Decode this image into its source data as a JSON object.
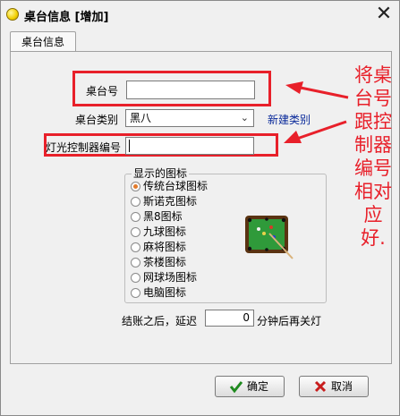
{
  "window": {
    "title": "桌台信息 [增加]",
    "close_glyph": "✕"
  },
  "tabs": [
    {
      "label": "桌台信息"
    }
  ],
  "form": {
    "table_number_label": "桌台号",
    "table_number_value": "",
    "table_type_label": "桌台类别",
    "table_type_value": "黑八",
    "new_type_link": "新建类别",
    "light_controller_label": "灯光控制器编号",
    "light_controller_value": ""
  },
  "icon_group": {
    "legend": "显示的图标",
    "options": [
      {
        "label": "传统台球图标",
        "selected": true
      },
      {
        "label": "斯诺克图标",
        "selected": false
      },
      {
        "label": "黑8图标",
        "selected": false
      },
      {
        "label": "九球图标",
        "selected": false
      },
      {
        "label": "麻将图标",
        "selected": false
      },
      {
        "label": "茶楼图标",
        "selected": false
      },
      {
        "label": "网球场图标",
        "selected": false
      },
      {
        "label": "电脑图标",
        "selected": false
      }
    ],
    "preview_icon": "billiard-table-icon"
  },
  "checkout": {
    "prefix": "结账之后，延迟",
    "delay_value": "0",
    "suffix": "分钟后再关灯"
  },
  "annotation": {
    "lines": [
      "将桌",
      "台号",
      "跟控",
      "制器",
      "编号",
      "相对",
      "应好."
    ]
  },
  "buttons": {
    "ok_label": "确定",
    "cancel_label": "取消"
  },
  "colors": {
    "highlight_red": "#e8202a",
    "link_blue": "#0a2a9a",
    "selected_radio": "#e27b2b",
    "ok_check": "#1f8a1f",
    "cancel_x": "#c81d1d"
  }
}
